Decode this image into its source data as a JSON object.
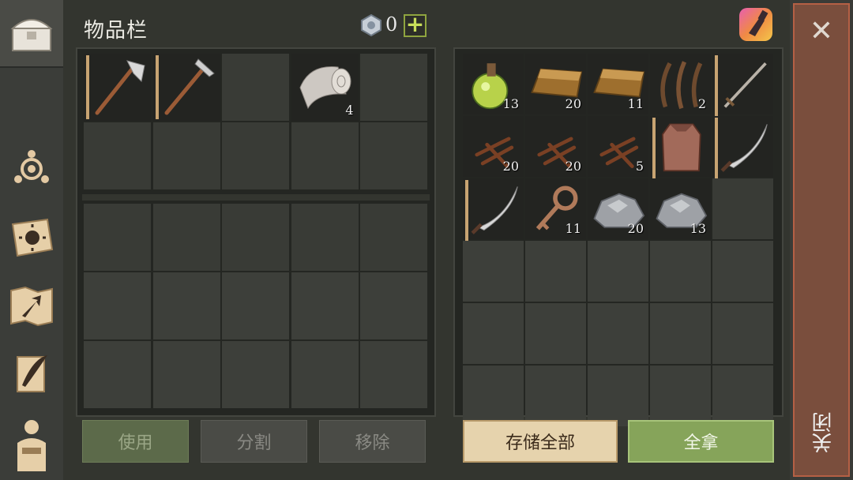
{
  "header": {
    "title": "物品栏",
    "currency": "0",
    "plus_label": "+"
  },
  "sidebar": {
    "items": [
      "chest-icon",
      "compass-icon",
      "sun-book-icon",
      "map-arrow-icon",
      "quill-scroll-icon",
      "character-icon"
    ]
  },
  "inventory": {
    "slots": [
      {
        "icon": "hatchet-icon",
        "qty": ""
      },
      {
        "icon": "pickaxe-icon",
        "qty": ""
      },
      {
        "icon": "",
        "qty": ""
      },
      {
        "icon": "cloth-roll-icon",
        "qty": "4"
      },
      {
        "icon": "",
        "qty": ""
      }
    ]
  },
  "storage": {
    "slots": [
      {
        "icon": "potion-icon",
        "qty": "13"
      },
      {
        "icon": "ingot-icon",
        "qty": "20"
      },
      {
        "icon": "ingot-icon",
        "qty": "11"
      },
      {
        "icon": "leather-strips-icon",
        "qty": "2"
      },
      {
        "icon": "sword-icon",
        "qty": ""
      },
      {
        "icon": "nails-icon",
        "qty": "20"
      },
      {
        "icon": "nails-icon",
        "qty": "20"
      },
      {
        "icon": "nails-icon",
        "qty": "5"
      },
      {
        "icon": "chainmail-icon",
        "qty": ""
      },
      {
        "icon": "scimitar-icon",
        "qty": ""
      },
      {
        "icon": "scimitar-icon",
        "qty": ""
      },
      {
        "icon": "key-icon",
        "qty": "11"
      },
      {
        "icon": "stone-ore-icon",
        "qty": "20"
      },
      {
        "icon": "stone-ore-icon",
        "qty": "13"
      },
      {
        "icon": "",
        "qty": ""
      }
    ]
  },
  "buttons": {
    "use": "使用",
    "split": "分割",
    "remove": "移除",
    "store_all": "存储全部",
    "take_all": "全拿"
  },
  "close": {
    "label": "关闭"
  }
}
